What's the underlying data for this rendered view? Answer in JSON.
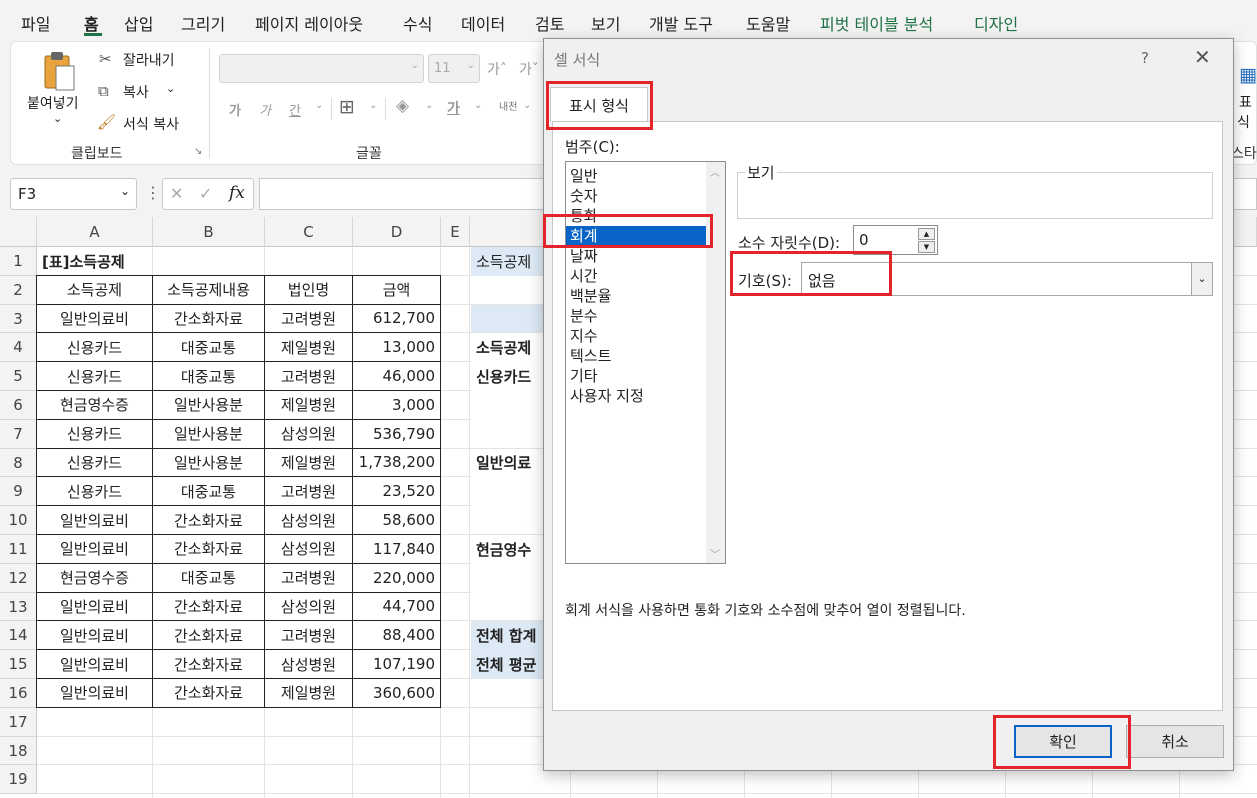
{
  "menu": {
    "items": [
      {
        "label": "파일",
        "green": false,
        "active": false
      },
      {
        "label": "홈",
        "green": false,
        "active": true
      },
      {
        "label": "삽입",
        "green": false,
        "active": false
      },
      {
        "label": "그리기",
        "green": false,
        "active": false
      },
      {
        "label": "페이지 레이아웃",
        "green": false,
        "active": false
      },
      {
        "label": "수식",
        "green": false,
        "active": false
      },
      {
        "label": "데이터",
        "green": false,
        "active": false
      },
      {
        "label": "검토",
        "green": false,
        "active": false
      },
      {
        "label": "보기",
        "green": false,
        "active": false
      },
      {
        "label": "개발 도구",
        "green": false,
        "active": false
      },
      {
        "label": "도움말",
        "green": false,
        "active": false
      },
      {
        "label": "피벗 테이블 분석",
        "green": true,
        "active": false
      },
      {
        "label": "디자인",
        "green": true,
        "active": false
      }
    ]
  },
  "ribbon": {
    "paste_label": "붙여넣기",
    "cut_label": "잘라내기",
    "copy_label": "복사",
    "format_painter_label": "서식 복사",
    "clipboard_group": "클립보드",
    "font_group": "글꼴",
    "font_size": "11",
    "bold_glyph": "가",
    "italic_glyph": "가",
    "underline_glyph": "간",
    "font_color_glyph": "가",
    "wrap_label": "내천",
    "right_cut_label": "표",
    "right_cut_label2": "식",
    "right_group_cut": "스타"
  },
  "formula_bar": {
    "name_box": "F3",
    "cancel_glyph": "✕",
    "enter_glyph": "✓",
    "fx_glyph": "fx",
    "value": ""
  },
  "sheet": {
    "columns": [
      "A",
      "B",
      "C",
      "D",
      "E"
    ],
    "row_numbers": [
      "1",
      "2",
      "3",
      "4",
      "5",
      "6",
      "7",
      "8",
      "9",
      "10",
      "11",
      "12",
      "13",
      "14",
      "15",
      "16",
      "17",
      "18",
      "19"
    ],
    "table_title": "[표]소득공제",
    "headers": [
      "소득공제",
      "소득공제내용",
      "법인명",
      "금액"
    ],
    "rows": [
      [
        "일반의료비",
        "간소화자료",
        "고려병원",
        "612,700"
      ],
      [
        "신용카드",
        "대중교통",
        "제일병원",
        "13,000"
      ],
      [
        "신용카드",
        "대중교통",
        "고려병원",
        "46,000"
      ],
      [
        "현금영수증",
        "일반사용분",
        "제일병원",
        "3,000"
      ],
      [
        "신용카드",
        "일반사용분",
        "삼성의원",
        "536,790"
      ],
      [
        "신용카드",
        "일반사용분",
        "제일병원",
        "1,738,200"
      ],
      [
        "신용카드",
        "대중교통",
        "고려병원",
        "23,520"
      ],
      [
        "일반의료비",
        "간소화자료",
        "삼성의원",
        "58,600"
      ],
      [
        "일반의료비",
        "간소화자료",
        "삼성의원",
        "117,840"
      ],
      [
        "현금영수증",
        "대중교통",
        "고려병원",
        "220,000"
      ],
      [
        "일반의료비",
        "간소화자료",
        "삼성의원",
        "44,700"
      ],
      [
        "일반의료비",
        "간소화자료",
        "고려병원",
        "88,400"
      ],
      [
        "일반의료비",
        "간소화자료",
        "삼성병원",
        "107,190"
      ],
      [
        "일반의료비",
        "간소화자료",
        "제일병원",
        "360,600"
      ]
    ],
    "col_f_visible": [
      {
        "row": 1,
        "text": "소득공제",
        "bold": false
      },
      {
        "row": 4,
        "text": "소득공제",
        "bold": true
      },
      {
        "row": 5,
        "text": "신용카드",
        "bold": true
      },
      {
        "row": 8,
        "text": "일반의료",
        "bold": true
      },
      {
        "row": 11,
        "text": "현금영수",
        "bold": true
      },
      {
        "row": 14,
        "text": "전체 합계",
        "bold": true
      },
      {
        "row": 15,
        "text": "전체 평균",
        "bold": true
      }
    ]
  },
  "dialog": {
    "title": "셀 서식",
    "help": "?",
    "close": "✕",
    "tab": "표시 형식",
    "category_label": "범주(C):",
    "categories": [
      "일반",
      "숫자",
      "통화",
      "회계",
      "날짜",
      "시간",
      "백분율",
      "분수",
      "지수",
      "텍스트",
      "기타",
      "사용자 지정"
    ],
    "selected_category": "회계",
    "preview_label": "보기",
    "decimal_label": "소수 자릿수(D):",
    "decimal_value": "0",
    "symbol_label": "기호(S):",
    "symbol_value": "없음",
    "description": "회계 서식을 사용하면 통화 기호와 소수점에 맞추어 열이 정렬됩니다.",
    "ok": "확인",
    "cancel": "취소"
  },
  "colors": {
    "excel_green": "#1e7145",
    "highlight_red": "#e3242b",
    "selection_blue": "#0a64c8"
  }
}
